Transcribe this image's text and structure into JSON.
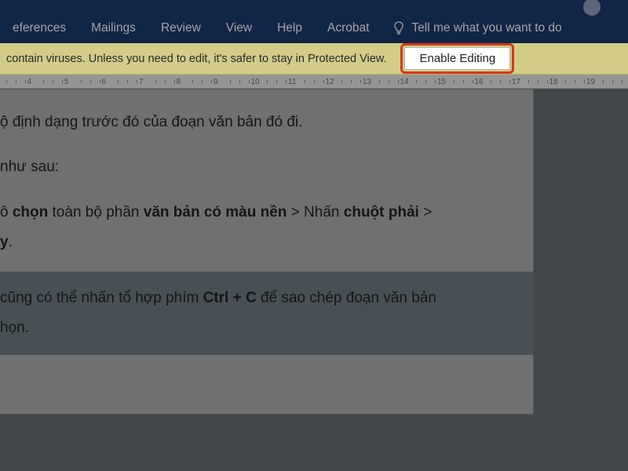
{
  "ribbon": {
    "tabs": [
      {
        "label": "eferences"
      },
      {
        "label": "Mailings"
      },
      {
        "label": "Review"
      },
      {
        "label": "View"
      },
      {
        "label": "Help"
      },
      {
        "label": "Acrobat"
      }
    ],
    "tell_me_placeholder": "Tell me what you want to do"
  },
  "protected_view": {
    "message": " contain viruses. Unless you need to edit, it's safer to stay in Protected View.",
    "enable_label": "Enable Editing"
  },
  "ruler": {
    "start": 3,
    "end": 19
  },
  "document": {
    "line1_plain": "ộ định dạng trước đó của đoạn văn bản đó đi.",
    "line2_plain": "như sau:",
    "step": {
      "pre1": "ô ",
      "b1": "chọn",
      "mid1": " toàn bộ phần ",
      "b2": "văn bản có màu nền",
      "mid2": " > Nhấn ",
      "b3": "chuột phải",
      "mid3": " >",
      "line2_b": "y",
      "line2_tail": "."
    },
    "selected": {
      "pre": " cũng có thể nhấn tổ hợp phím ",
      "b": "Ctrl + C",
      "post": " để sao chép đoạn văn bản",
      "line2": "họn."
    }
  }
}
